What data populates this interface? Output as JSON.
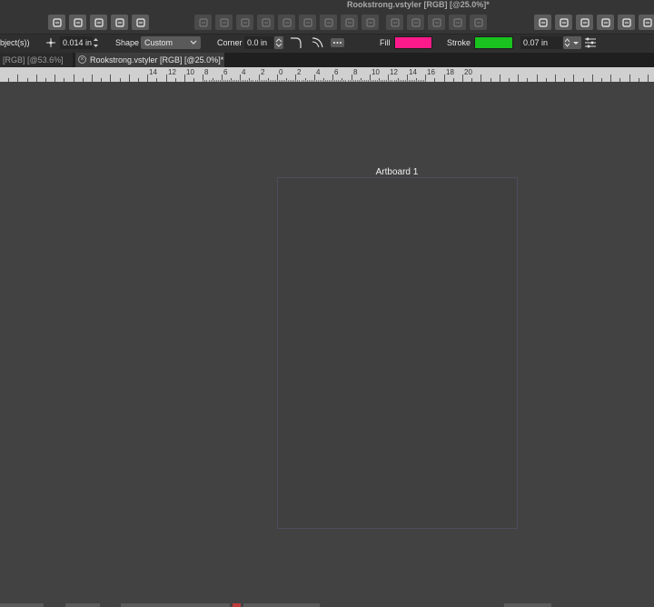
{
  "window": {
    "title": "Rookstrong.vstyler [RGB] [@25.0%]*"
  },
  "toolbar": {
    "left_group": [
      "align-left-icon",
      "flag-icon",
      "transform-icon",
      "link-icon",
      "copy-icon"
    ],
    "middle_group": [
      "boolean-add-icon",
      "boolean-subtract-icon",
      "boolean-intersect-icon",
      "boolean-divide-icon",
      "group-icon",
      "ungroup-icon",
      "combine-icon",
      "separate-icon",
      "shape-icon"
    ],
    "right_group": [
      "arrange-forward-icon",
      "arrange-back-icon",
      "arrange-front-icon",
      "arrange-behind-icon",
      "snapping-icon"
    ],
    "far_right": [
      "share-icon",
      "export-icon",
      "preferences-icon",
      "front-icon",
      "back-icon",
      "upload-icon"
    ]
  },
  "context_bar": {
    "selection_label": "bject(s))",
    "position_value": "0.014 in",
    "shape_label": "Shape",
    "shape_value": "Custom",
    "corner_label": "Corner",
    "corner_value": "0.0 in",
    "fill_label": "Fill",
    "fill_color": "#ff1a8c",
    "stroke_label": "Stroke",
    "stroke_color": "#19c21e",
    "stroke_width": "0.07 in"
  },
  "tabs": [
    {
      "label": "[RGB] [@53.6%]"
    },
    {
      "label": "Rookstrong.vstyler [RGB] [@25.0%]*"
    }
  ],
  "ruler": {
    "labels": [
      "14",
      "12",
      "10",
      "8",
      "6",
      "4",
      "2",
      "0",
      "2",
      "4",
      "6",
      "8",
      "10",
      "12",
      "14",
      "16",
      "18",
      "20"
    ]
  },
  "canvas": {
    "artboard_label": "Artboard 1"
  }
}
